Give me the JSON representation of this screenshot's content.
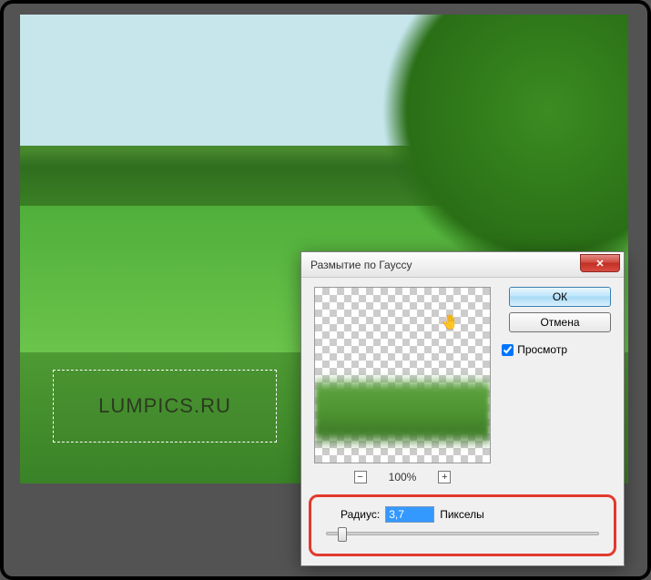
{
  "watermark": "LUMPICS.RU",
  "dialog": {
    "title": "Размытие по Гауссу",
    "ok_label": "ОК",
    "cancel_label": "Отмена",
    "preview_label": "Просмотр",
    "zoom_value": "100%",
    "radius_label": "Радиус:",
    "radius_value": "3,7",
    "radius_unit": "Пикселы",
    "close_glyph": "✕",
    "zoom_out_glyph": "−",
    "zoom_in_glyph": "+",
    "hand_glyph": "✋"
  }
}
